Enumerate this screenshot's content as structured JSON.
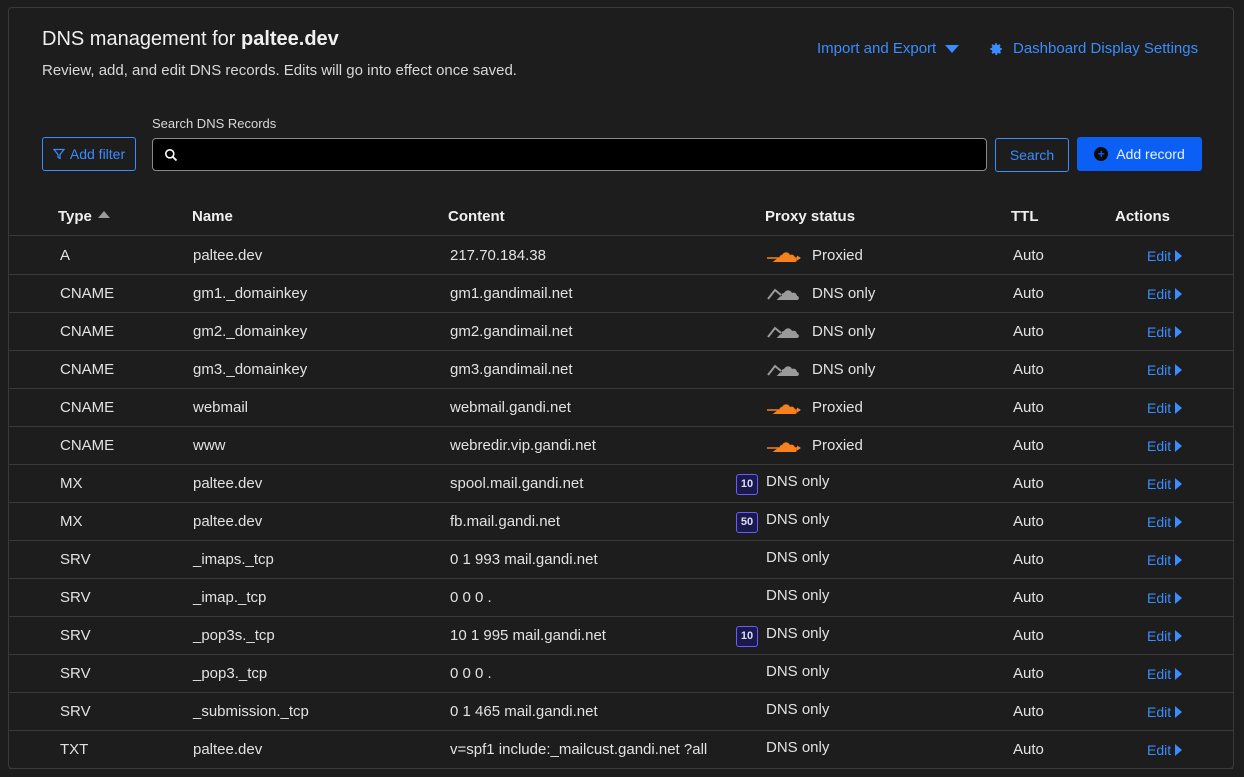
{
  "header": {
    "title_prefix": "DNS management for ",
    "domain": "paltee.dev",
    "subtitle": "Review, add, and edit DNS records. Edits will go into effect once saved.",
    "import_export_label": "Import and Export",
    "settings_label": "Dashboard Display Settings"
  },
  "toolbar": {
    "filter_label": "Add filter",
    "search_label": "Search DNS Records",
    "search_value": "",
    "search_button": "Search",
    "add_record_button": "Add record"
  },
  "table": {
    "columns": {
      "type": "Type",
      "name": "Name",
      "content": "Content",
      "proxy": "Proxy status",
      "ttl": "TTL",
      "actions": "Actions"
    },
    "edit_label": "Edit",
    "rows": [
      {
        "type": "A",
        "name": "paltee.dev",
        "content": "217.70.184.38",
        "proxy": "Proxied",
        "icon": "cloud-proxied-icon",
        "priority": "",
        "ttl": "Auto"
      },
      {
        "type": "CNAME",
        "name": "gm1._domainkey",
        "content": "gm1.gandimail.net",
        "proxy": "DNS only",
        "icon": "cloud-dns-only-icon",
        "priority": "",
        "ttl": "Auto"
      },
      {
        "type": "CNAME",
        "name": "gm2._domainkey",
        "content": "gm2.gandimail.net",
        "proxy": "DNS only",
        "icon": "cloud-dns-only-icon",
        "priority": "",
        "ttl": "Auto"
      },
      {
        "type": "CNAME",
        "name": "gm3._domainkey",
        "content": "gm3.gandimail.net",
        "proxy": "DNS only",
        "icon": "cloud-dns-only-icon",
        "priority": "",
        "ttl": "Auto"
      },
      {
        "type": "CNAME",
        "name": "webmail",
        "content": "webmail.gandi.net",
        "proxy": "Proxied",
        "icon": "cloud-proxied-icon",
        "priority": "",
        "ttl": "Auto"
      },
      {
        "type": "CNAME",
        "name": "www",
        "content": "webredir.vip.gandi.net",
        "proxy": "Proxied",
        "icon": "cloud-proxied-icon",
        "priority": "",
        "ttl": "Auto"
      },
      {
        "type": "MX",
        "name": "paltee.dev",
        "content": "spool.mail.gandi.net",
        "proxy": "DNS only",
        "icon": "",
        "priority": "10",
        "ttl": "Auto"
      },
      {
        "type": "MX",
        "name": "paltee.dev",
        "content": "fb.mail.gandi.net",
        "proxy": "DNS only",
        "icon": "",
        "priority": "50",
        "ttl": "Auto"
      },
      {
        "type": "SRV",
        "name": "_imaps._tcp",
        "content": "0 1 993 mail.gandi.net",
        "proxy": "DNS only",
        "icon": "",
        "priority": "",
        "ttl": "Auto"
      },
      {
        "type": "SRV",
        "name": "_imap._tcp",
        "content": "0 0 0 .",
        "proxy": "DNS only",
        "icon": "",
        "priority": "",
        "ttl": "Auto"
      },
      {
        "type": "SRV",
        "name": "_pop3s._tcp",
        "content": "10 1 995 mail.gandi.net",
        "proxy": "DNS only",
        "icon": "",
        "priority": "10",
        "ttl": "Auto"
      },
      {
        "type": "SRV",
        "name": "_pop3._tcp",
        "content": "0 0 0 .",
        "proxy": "DNS only",
        "icon": "",
        "priority": "",
        "ttl": "Auto"
      },
      {
        "type": "SRV",
        "name": "_submission._tcp",
        "content": "0 1 465 mail.gandi.net",
        "proxy": "DNS only",
        "icon": "",
        "priority": "",
        "ttl": "Auto"
      },
      {
        "type": "TXT",
        "name": "paltee.dev",
        "content": "v=spf1 include:_mailcust.gandi.net ?all",
        "proxy": "DNS only",
        "icon": "",
        "priority": "",
        "ttl": "Auto"
      }
    ]
  },
  "colors": {
    "accent": "#3b8cff",
    "primary_button": "#0b5ff5",
    "proxied_cloud": "#f6821f",
    "dns_only_cloud": "#9a9a9a",
    "background": "#1d1d1d"
  }
}
